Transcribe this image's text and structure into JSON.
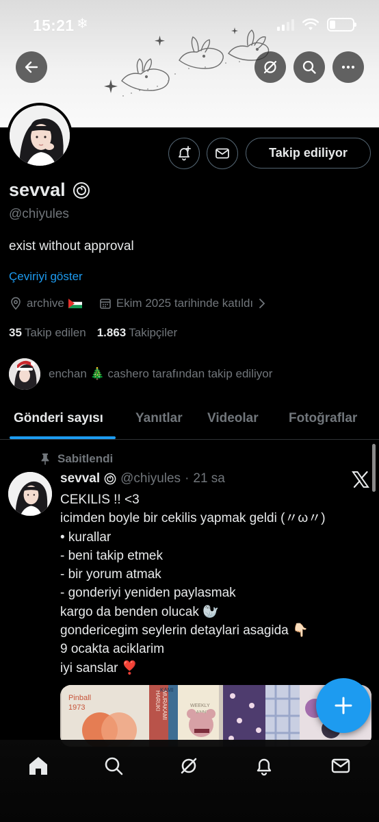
{
  "status_bar": {
    "time": "15:21",
    "weather_glyph": "❄"
  },
  "header": {
    "back_icon": "arrow-left-icon",
    "grok_icon": "slash-circle-icon",
    "search_icon": "search-icon",
    "more_icon": "more-horizontal-icon"
  },
  "profile": {
    "display_name": "sevval",
    "name_badge_glyph": "🌀",
    "handle": "@chiyules",
    "bio": "exist without approval",
    "translate_link": "Çeviriyi göster",
    "location": "archive",
    "location_flag": "🇵🇸",
    "joined": "Ekim 2025 tarihinde katıldı",
    "following_count": "35",
    "following_label": "Takip edilen",
    "followers_count": "1.863",
    "followers_label": "Takipçiler",
    "follow_button": "Takip ediliyor",
    "followed_by": "enchan 🎄 cashero tarafından takip ediliyor"
  },
  "tabs": [
    {
      "label": "Gönderi sayısı",
      "active": true
    },
    {
      "label": "Yanıtlar",
      "active": false
    },
    {
      "label": "Videolar",
      "active": false
    },
    {
      "label": "Fotoğraflar",
      "active": false
    }
  ],
  "tweet": {
    "pinned_label": "Sabitlendi",
    "author_name": "sevval",
    "author_badge": "🌀",
    "author_handle": "@chiyules",
    "separator": "·",
    "time": "21 sa",
    "lines": [
      "CEKILIS !! <3",
      "icimden boyle bir cekilis yapmak geldi (〃ω〃)",
      "• kurallar",
      "- beni takip etmek",
      "- bir yorum atmak",
      "- gonderiyi yeniden paylasmak",
      "kargo da benden olucak 🦭",
      "gondericegim seylerin detaylari asagida 👇🏻",
      "9 ocakta aciklarim",
      "iyi sanslar ❣️"
    ],
    "media_texts": [
      "Pinball",
      "1973",
      "HARUKI",
      "MURAKAMI",
      "WEEKLY",
      "PLANNER",
      "KAMI"
    ]
  },
  "bottom_nav": [
    "home-icon",
    "search-icon",
    "grok-icon",
    "notifications-icon",
    "messages-icon"
  ],
  "colors": {
    "accent": "#1d9bf0",
    "background": "#000000",
    "secondary_text": "#71767b"
  }
}
